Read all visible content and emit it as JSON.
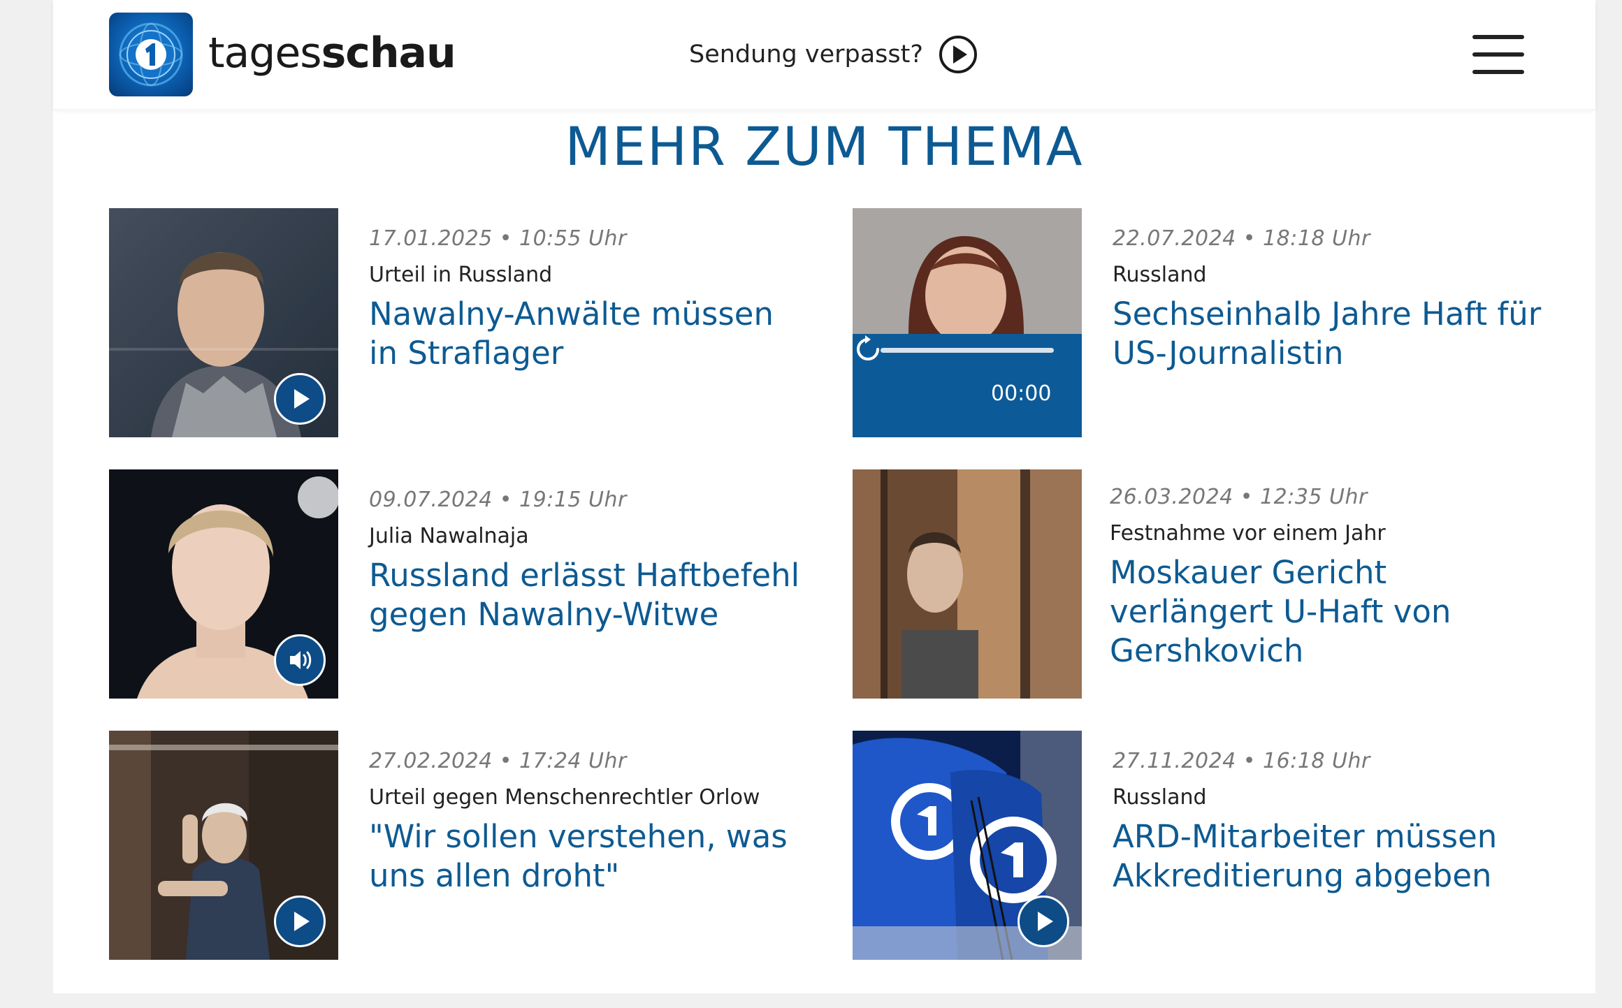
{
  "header": {
    "logo_text_light": "tages",
    "logo_text_bold": "schau",
    "missed_label": "Sendung verpasst?"
  },
  "section": {
    "title": "MEHR ZUM THEMA"
  },
  "articles": [
    {
      "date": "17.01.2025 • 10:55 Uhr",
      "topline": "Urteil in Russland",
      "headline": "Nawalny-Anwälte müssen in Straflager",
      "media": "video",
      "badge_icon": "play-icon"
    },
    {
      "date": "22.07.2024 • 18:18 Uhr",
      "topline": "Russland",
      "headline": "Sechseinhalb Jahre Haft für US-Journalistin",
      "media": "audio-player",
      "audio_time": "00:00",
      "audio_progress": 0
    },
    {
      "date": "09.07.2024 • 19:15 Uhr",
      "topline": "Julia Nawalnaja",
      "headline": "Russland erlässt Haftbefehl gegen Nawalny-Witwe",
      "media": "audio",
      "badge_icon": "speaker-icon"
    },
    {
      "date": "26.03.2024 • 12:35 Uhr",
      "topline": "Festnahme vor einem Jahr",
      "headline": "Moskauer Gericht verlängert U-Haft von Gershkovich",
      "media": "image"
    },
    {
      "date": "27.02.2024 • 17:24 Uhr",
      "topline": "Urteil gegen Menschenrechtler Orlow",
      "headline": "\"Wir sollen verstehen, was uns allen droht\"",
      "media": "video",
      "badge_icon": "play-icon"
    },
    {
      "date": "27.11.2024 • 16:18 Uhr",
      "topline": "Russland",
      "headline": "ARD-Mitarbeiter müssen Akkreditierung abgeben",
      "media": "video",
      "badge_icon": "play-icon"
    }
  ],
  "colors": {
    "brand_blue": "#0d5a92",
    "badge_blue": "#0d4c86",
    "meta_gray": "#777777"
  }
}
